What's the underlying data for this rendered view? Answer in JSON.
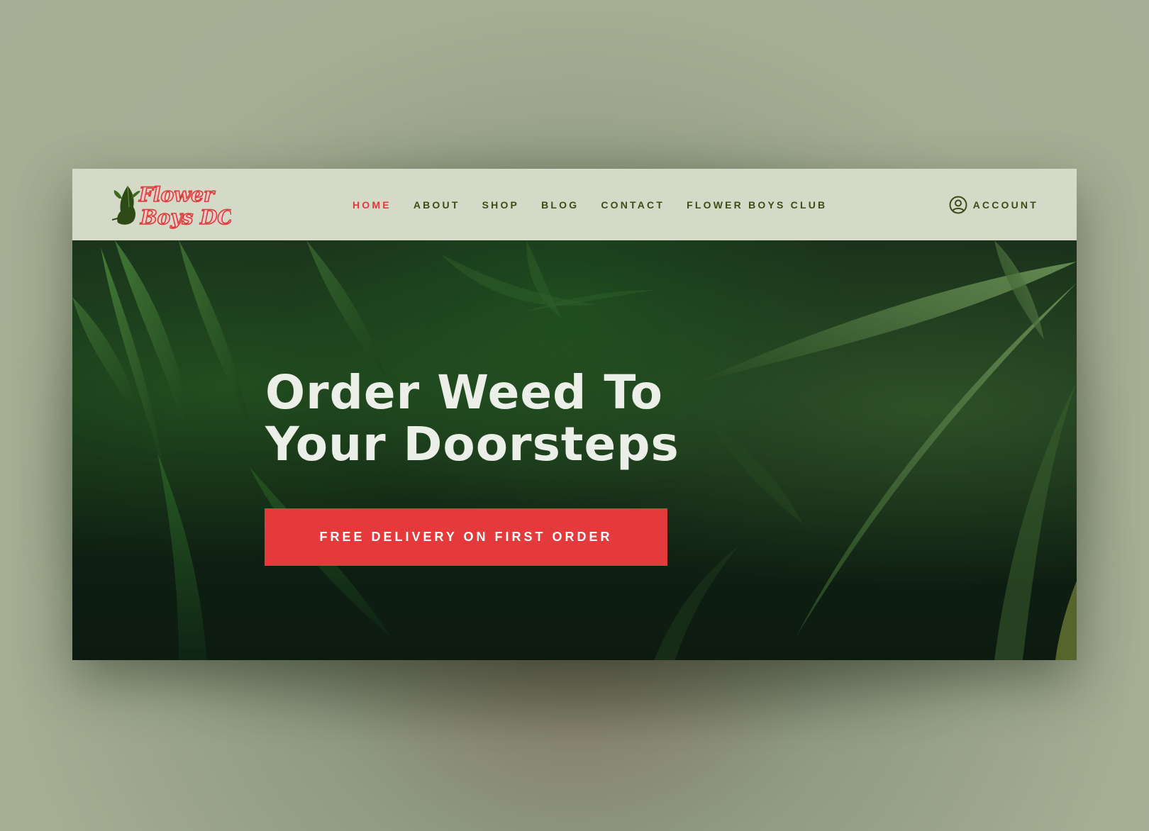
{
  "brand": {
    "logo_line1": "Flower",
    "logo_line2": "Boys DC",
    "logo_color": "#e03a3a",
    "logo_icon": "leaf-profile-icon"
  },
  "nav": {
    "items": [
      {
        "label": "HOME",
        "active": true
      },
      {
        "label": "ABOUT",
        "active": false
      },
      {
        "label": "SHOP",
        "active": false
      },
      {
        "label": "BLOG",
        "active": false
      },
      {
        "label": "CONTACT",
        "active": false
      },
      {
        "label": "FLOWER BOYS CLUB",
        "active": false
      }
    ],
    "account_label": "ACCOUNT",
    "account_icon": "user-circle-icon",
    "text_color": "#3b4c16",
    "active_color": "#e03a3a",
    "background": "#d4dac7"
  },
  "hero": {
    "title_line1": "Order Weed To",
    "title_line2": "Your Doorsteps",
    "cta_label": "FREE DELIVERY ON FIRST ORDER",
    "cta_color": "#e43a3c",
    "background_image": "cannabis-leaves-photo"
  }
}
